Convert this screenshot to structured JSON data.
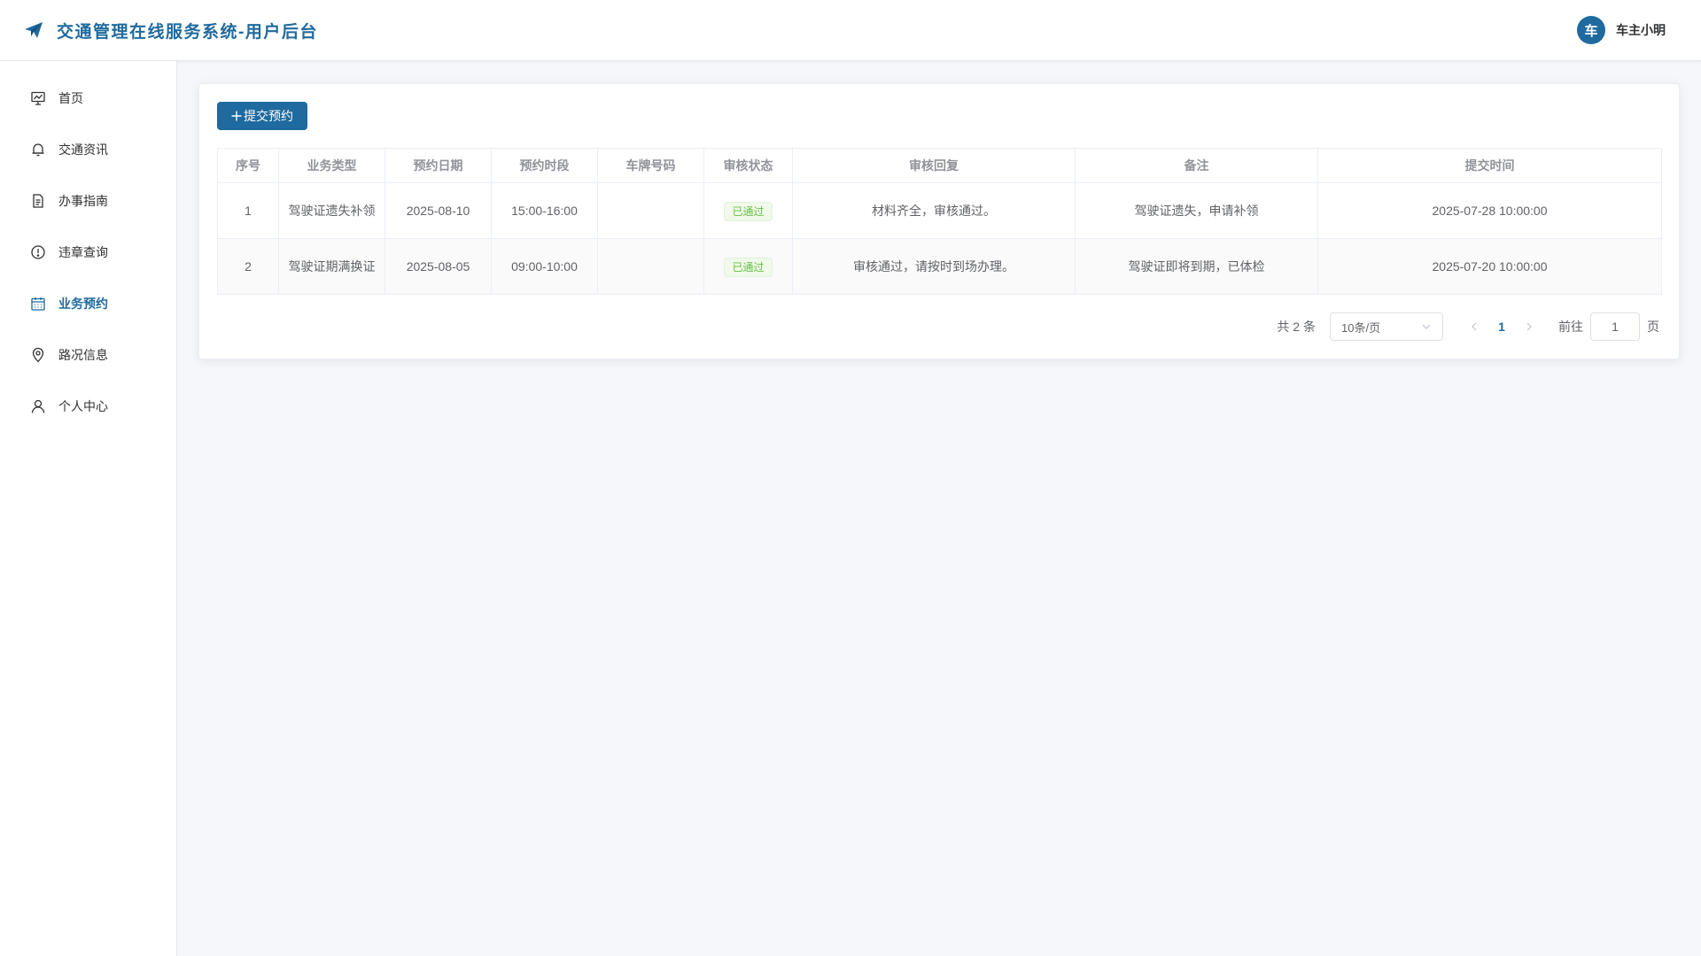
{
  "header": {
    "title": "交通管理在线服务系统-用户后台",
    "avatar_text": "车",
    "user_name": "车主小明"
  },
  "sidebar": {
    "items": [
      {
        "label": "首页",
        "icon": "presentation-chart-icon",
        "active": false
      },
      {
        "label": "交通资讯",
        "icon": "bell-icon",
        "active": false
      },
      {
        "label": "办事指南",
        "icon": "document-icon",
        "active": false
      },
      {
        "label": "违章查询",
        "icon": "warning-circle-icon",
        "active": false
      },
      {
        "label": "业务预约",
        "icon": "calendar-icon",
        "active": true
      },
      {
        "label": "路况信息",
        "icon": "location-pin-icon",
        "active": false
      },
      {
        "label": "个人中心",
        "icon": "user-icon",
        "active": false
      }
    ]
  },
  "toolbar": {
    "submit_label": "提交预约"
  },
  "table": {
    "columns": [
      "序号",
      "业务类型",
      "预约日期",
      "预约时段",
      "车牌号码",
      "审核状态",
      "审核回复",
      "备注",
      "提交时间"
    ],
    "rows": [
      {
        "index": "1",
        "type": "驾驶证遗失补领",
        "date": "2025-08-10",
        "slot": "15:00-16:00",
        "plate": "",
        "status": "已通过",
        "reply": "材料齐全，审核通过。",
        "remark": "驾驶证遗失，申请补领",
        "submitted": "2025-07-28 10:00:00"
      },
      {
        "index": "2",
        "type": "驾驶证期满换证",
        "date": "2025-08-05",
        "slot": "09:00-10:00",
        "plate": "",
        "status": "已通过",
        "reply": "审核通过，请按时到场办理。",
        "remark": "驾驶证即将到期，已体检",
        "submitted": "2025-07-20 10:00:00"
      }
    ]
  },
  "pagination": {
    "total_text": "共 2 条",
    "page_size": "10条/页",
    "current_page": "1",
    "goto_prefix": "前往",
    "goto_value": "1",
    "goto_suffix": "页"
  },
  "colors": {
    "primary": "#1f6a9e",
    "success": "#67c23a"
  }
}
